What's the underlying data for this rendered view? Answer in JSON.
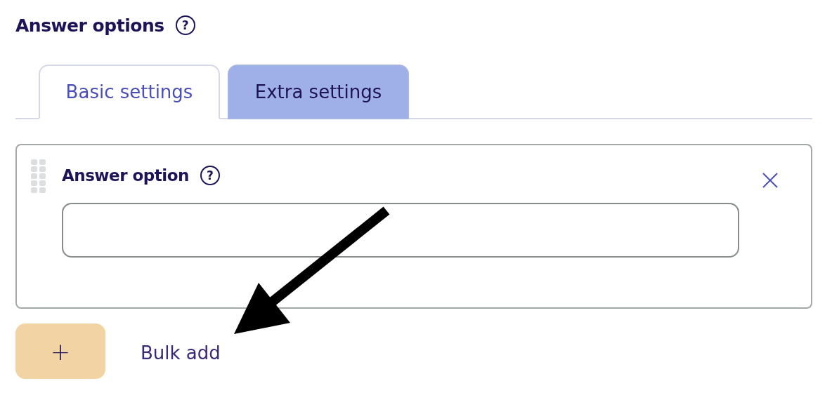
{
  "section": {
    "title": "Answer options",
    "help": "?"
  },
  "tabs": [
    {
      "label": "Basic settings",
      "selected": true
    },
    {
      "label": "Extra settings",
      "selected": false
    }
  ],
  "option_card": {
    "title": "Answer option",
    "help": "?"
  },
  "actions": {
    "add_button": "+",
    "bulk_add": "Bulk add"
  }
}
